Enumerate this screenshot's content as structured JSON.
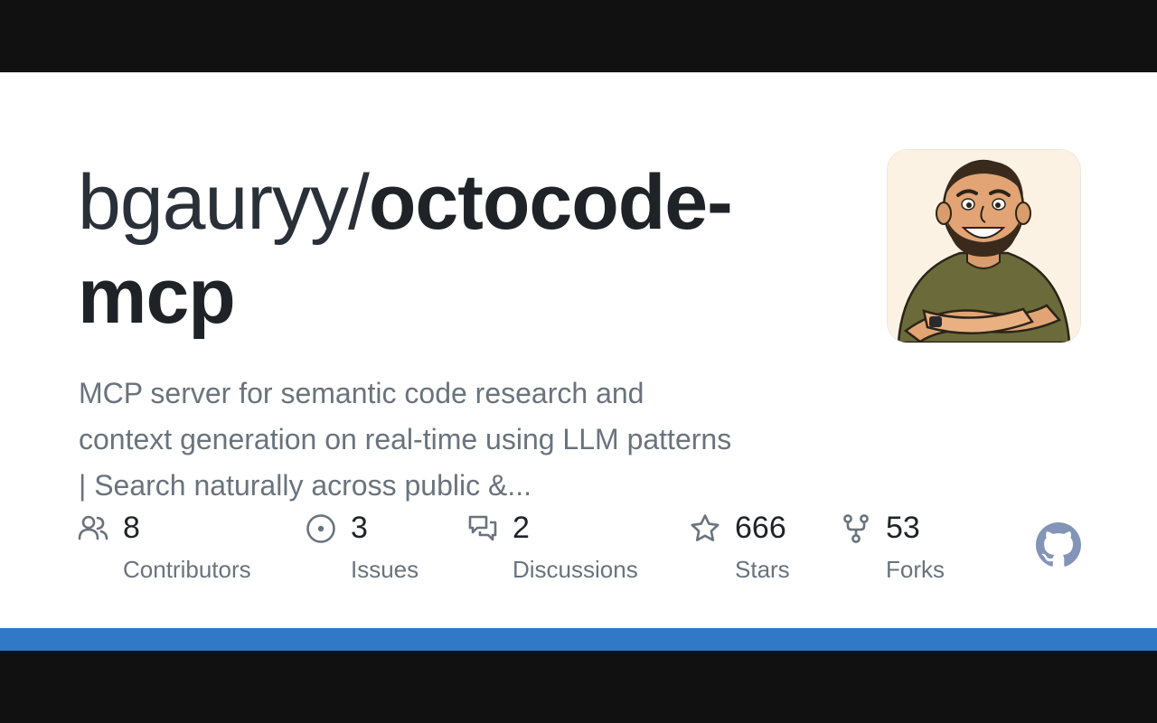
{
  "repo": {
    "owner": "bgauryy/",
    "name_line1": "octocode-",
    "name_line2": "mcp",
    "description_lines": [
      "MCP server for semantic code research and",
      "context generation on real-time using LLM patterns",
      "| Search naturally across public &..."
    ]
  },
  "stats": [
    {
      "icon": "people-icon",
      "value": "8",
      "label": "Contributors"
    },
    {
      "icon": "issue-opened-icon",
      "value": "3",
      "label": "Issues"
    },
    {
      "icon": "discussion-icon",
      "value": "2",
      "label": "Discussions"
    },
    {
      "icon": "star-icon",
      "value": "666",
      "label": "Stars"
    },
    {
      "icon": "repo-forked-icon",
      "value": "53",
      "label": "Forks"
    }
  ],
  "brand": {
    "logo": "github-mark-icon",
    "logo_color": "#8295b8",
    "accent_color": "#3178c6"
  }
}
